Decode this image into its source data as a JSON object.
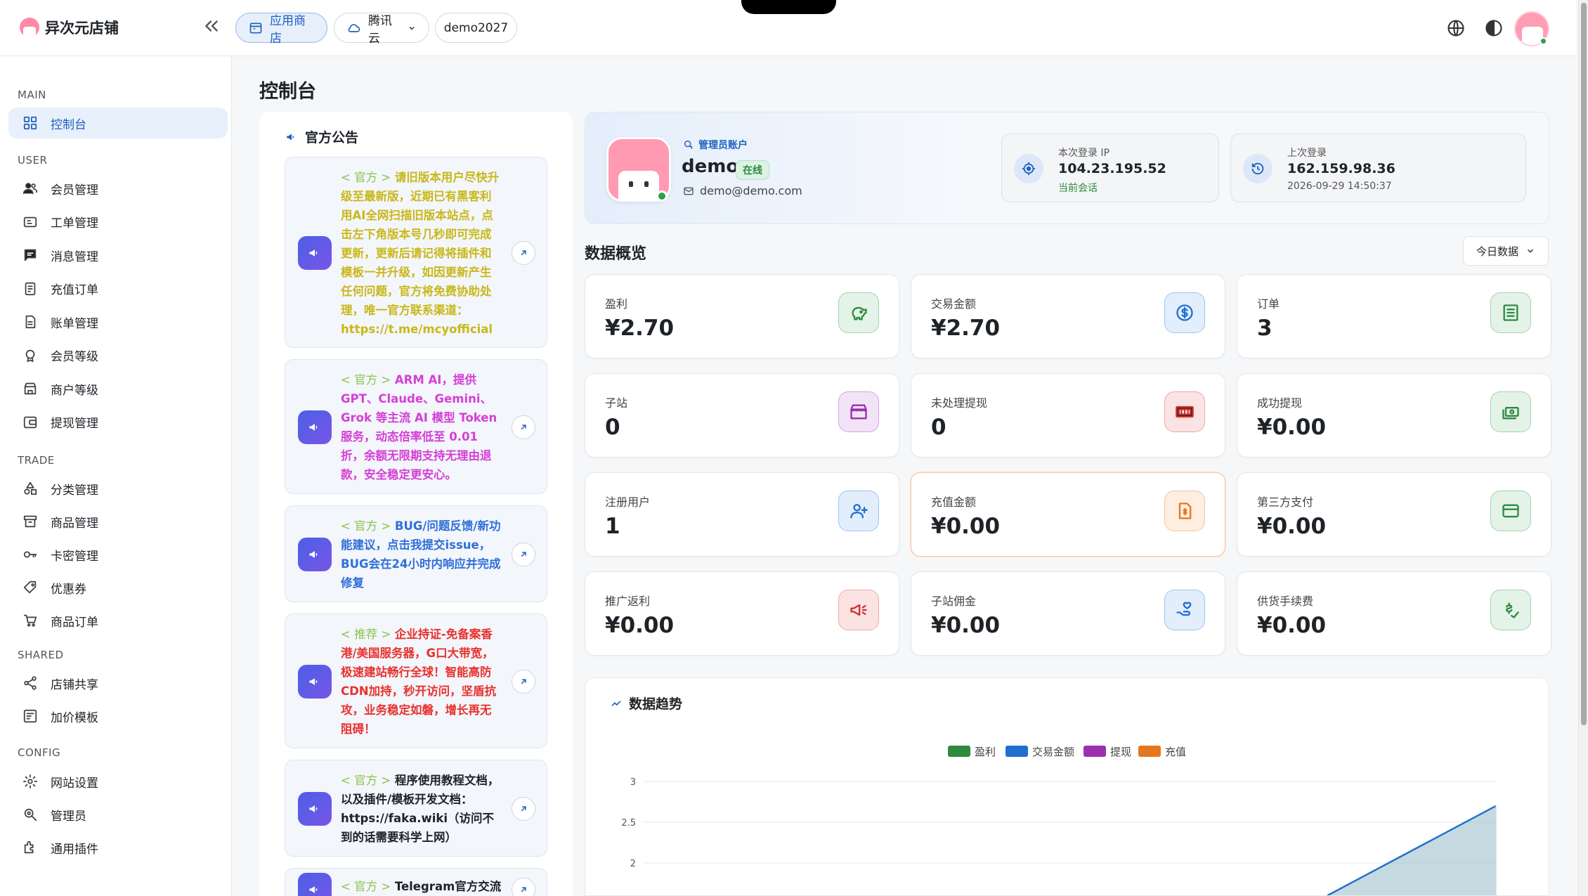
{
  "app": {
    "title": "异次元店铺"
  },
  "topbar": {
    "store_label": "应用商店",
    "cloud_label": "腾讯云",
    "user_label": "demo2027"
  },
  "sidebar": {
    "sections": [
      {
        "title": "MAIN",
        "items": [
          {
            "label": "控制台",
            "icon": "dashboard-icon"
          }
        ]
      },
      {
        "title": "USER",
        "items": [
          {
            "label": "会员管理",
            "icon": "users-icon"
          },
          {
            "label": "工单管理",
            "icon": "ticket-icon"
          },
          {
            "label": "消息管理",
            "icon": "message-icon"
          },
          {
            "label": "充值订单",
            "icon": "recharge-icon"
          },
          {
            "label": "账单管理",
            "icon": "bill-icon"
          },
          {
            "label": "会员等级",
            "icon": "badge-icon"
          },
          {
            "label": "商户等级",
            "icon": "shop-icon"
          },
          {
            "label": "提现管理",
            "icon": "withdraw-icon"
          }
        ]
      },
      {
        "title": "TRADE",
        "items": [
          {
            "label": "分类管理",
            "icon": "category-icon"
          },
          {
            "label": "商品管理",
            "icon": "product-icon"
          },
          {
            "label": "卡密管理",
            "icon": "key-icon"
          },
          {
            "label": "优惠券",
            "icon": "coupon-icon"
          },
          {
            "label": "商品订单",
            "icon": "cart-icon"
          }
        ]
      },
      {
        "title": "SHARED",
        "items": [
          {
            "label": "店铺共享",
            "icon": "share-icon"
          },
          {
            "label": "加价模板",
            "icon": "template-icon"
          }
        ]
      },
      {
        "title": "CONFIG",
        "items": [
          {
            "label": "网站设置",
            "icon": "gear-icon"
          },
          {
            "label": "管理员",
            "icon": "admin-icon"
          },
          {
            "label": "通用插件",
            "icon": "plugin-icon"
          }
        ]
      }
    ]
  },
  "page": {
    "title": "控制台"
  },
  "announcements": {
    "title": "官方公告",
    "items": [
      {
        "tag": "< 官方 >",
        "text": "请旧版本用户尽快升级至最新版，近期已有黑客利用AI全网扫描旧版本站点，点击左下角版本号几秒即可完成更新，更新后请记得将插件和模板一并升级，如因更新产生任何问题，官方将免费协助处理，唯一官方联系渠道：https://t.me/mcyofficial",
        "color": "#c9b81a"
      },
      {
        "tag": "< 官方 >",
        "text": "ARM AI，提供GPT、Claude、Gemini、Grok 等主流 AI 模型 Token 服务，动态倍率低至 0.01 折，余额无限期支持无理由退款，安全稳定更安心。",
        "color": "#d63fd6"
      },
      {
        "tag": "< 官方 >",
        "text": "BUG/问题反馈/新功能建议，点击我提交issue，BUG会在24小时内响应并完成修复",
        "color": "#2f6fd8"
      },
      {
        "tag": "< 推荐 >",
        "text": "企业持证-免备案香港/美国服务器，G口大带宽，极速建站畅行全球！智能高防CDN加持，秒开访问，坚盾抗攻，业务稳定如磐，增长再无阻碍！",
        "color": "#e8322f"
      },
      {
        "tag": "< 官方 >",
        "text": "程序使用教程文档，以及插件/模板开发文档：https://faka.wiki（访问不到的话需要科学上网）",
        "color": "#1f2328"
      },
      {
        "tag": "< 官方 >",
        "text": "Telegram官方交流",
        "color": "#1f2328"
      }
    ]
  },
  "profile": {
    "role": "管理员账户",
    "name": "demo",
    "status": "在线",
    "email": "demo@demo.com",
    "current_login": {
      "label": "本次登录 IP",
      "ip": "104.23.195.52",
      "note": "当前会话"
    },
    "last_login": {
      "label": "上次登录",
      "ip": "162.159.98.36",
      "time": "2026-09-29 14:50:37"
    }
  },
  "overview": {
    "title": "数据概览",
    "range": "今日数据",
    "stats": [
      {
        "label": "盈利",
        "value": "¥2.70",
        "icon": "piggy-bank-icon",
        "color": "#2f8a3e",
        "bg": "#e4f3e8"
      },
      {
        "label": "交易金额",
        "value": "¥2.70",
        "icon": "dollar-circle-icon",
        "color": "#1f6fd1",
        "bg": "#e2eefb"
      },
      {
        "label": "订单",
        "value": "3",
        "icon": "list-icon",
        "color": "#2f8a3e",
        "bg": "#e4f3e8"
      },
      {
        "label": "子站",
        "value": "0",
        "icon": "store-icon",
        "color": "#9b2fb0",
        "bg": "#f2e3f6"
      },
      {
        "label": "未处理提现",
        "value": "0",
        "icon": "cash-icon",
        "color": "#d62f2f",
        "bg": "#fbe3e3"
      },
      {
        "label": "成功提现",
        "value": "¥0.00",
        "icon": "money-icon",
        "color": "#2f8a3e",
        "bg": "#e4f3e8"
      },
      {
        "label": "注册用户",
        "value": "1",
        "icon": "add-user-icon",
        "color": "#1f6fd1",
        "bg": "#e2eefb"
      },
      {
        "label": "充值金额",
        "value": "¥0.00",
        "icon": "invoice-icon",
        "color": "#e6761e",
        "bg": "#fdeedf"
      },
      {
        "label": "第三方支付",
        "value": "¥0.00",
        "icon": "card-icon",
        "color": "#2f8a3e",
        "bg": "#e4f3e8"
      },
      {
        "label": "推广返利",
        "value": "¥0.00",
        "icon": "megaphone-icon",
        "color": "#d62f2f",
        "bg": "#fbe3e3"
      },
      {
        "label": "子站佣金",
        "value": "¥0.00",
        "icon": "hand-heart-icon",
        "color": "#1f6fd1",
        "bg": "#e2eefb"
      },
      {
        "label": "供货手续费",
        "value": "¥0.00",
        "icon": "check-money-icon",
        "color": "#2f8a3e",
        "bg": "#e4f3e8"
      }
    ]
  },
  "trend": {
    "title": "数据趋势"
  },
  "chart_data": {
    "type": "area",
    "ylim": [
      0,
      3
    ],
    "y_ticks": [
      "3",
      "2.5",
      "2"
    ],
    "legend_position": "top-center",
    "series": [
      {
        "name": "盈利",
        "color": "#2f8a3e"
      },
      {
        "name": "交易金额",
        "color": "#1f6fd1",
        "visible_segment": {
          "from": 1.6,
          "to": 2.7
        }
      },
      {
        "name": "提现",
        "color": "#9b2fb0"
      },
      {
        "name": "充值",
        "color": "#e6761e"
      }
    ]
  }
}
